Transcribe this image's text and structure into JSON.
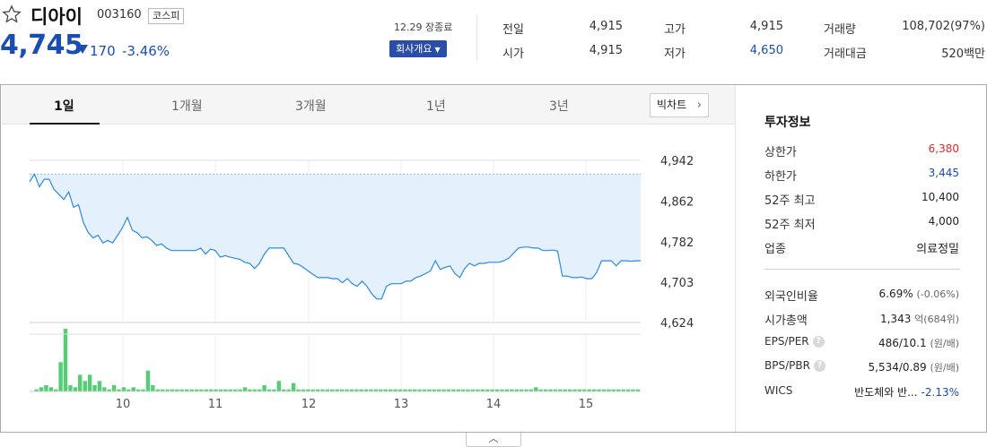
{
  "stock": {
    "name": "디아이",
    "code": "003160",
    "market": "코스피",
    "price": "4,745",
    "change": "170",
    "change_rate": "-3.46%",
    "as_of": "12.29 장종료",
    "company_button": "회사개요"
  },
  "quotes": {
    "prev_close_label": "전일",
    "prev_close": "4,915",
    "open_label": "시가",
    "open": "4,915",
    "high_label": "고가",
    "high": "4,915",
    "low_label": "저가",
    "low": "4,650",
    "volume_label": "거래량",
    "volume": "108,702(97%)",
    "trade_value_label": "거래대금",
    "trade_value": "520백만"
  },
  "tabs": [
    {
      "label": "1일",
      "active": true
    },
    {
      "label": "1개월",
      "active": false
    },
    {
      "label": "3개월",
      "active": false
    },
    {
      "label": "1년",
      "active": false
    },
    {
      "label": "3년",
      "active": false
    }
  ],
  "big_chart_label": "빅차트",
  "chart_data": {
    "type": "area",
    "y_ticks": [
      "4,942",
      "4,862",
      "4,782",
      "4,703",
      "4,624"
    ],
    "ylim": [
      4624,
      4942
    ],
    "prev_close": 4915,
    "x_ticks": [
      "10",
      "11",
      "12",
      "13",
      "14",
      "15"
    ],
    "price_series": [
      4900,
      4915,
      4890,
      4905,
      4905,
      4885,
      4875,
      4865,
      4880,
      4850,
      4855,
      4820,
      4800,
      4790,
      4795,
      4780,
      4785,
      4780,
      4795,
      4810,
      4830,
      4805,
      4800,
      4790,
      4792,
      4785,
      4775,
      4778,
      4770,
      4765,
      4765,
      4765,
      4765,
      4765,
      4765,
      4770,
      4758,
      4768,
      4765,
      4752,
      4755,
      4752,
      4750,
      4748,
      4742,
      4740,
      4730,
      4740,
      4758,
      4770,
      4770,
      4770,
      4770,
      4755,
      4740,
      4738,
      4732,
      4725,
      4718,
      4712,
      4712,
      4712,
      4710,
      4710,
      4702,
      4710,
      4700,
      4695,
      4705,
      4695,
      4680,
      4670,
      4670,
      4695,
      4700,
      4700,
      4700,
      4705,
      4705,
      4712,
      4715,
      4720,
      4725,
      4745,
      4728,
      4732,
      4735,
      4720,
      4712,
      4730,
      4740,
      4735,
      4740,
      4740,
      4742,
      4742,
      4742,
      4745,
      4750,
      4760,
      4770,
      4772,
      4772,
      4770,
      4770,
      4765,
      4765,
      4766,
      4764,
      4715,
      4715,
      4712,
      4712,
      4713,
      4710,
      4710,
      4722,
      4745,
      4745,
      4745,
      4735,
      4745,
      4745,
      4744,
      4745,
      4745
    ],
    "volume_series": [
      0,
      1,
      2,
      3,
      2,
      1,
      14,
      30,
      3,
      2,
      8,
      5,
      8,
      3,
      5,
      2,
      1,
      3,
      1,
      2,
      1,
      2,
      1,
      1,
      10,
      3,
      1,
      1,
      1,
      1,
      1,
      1,
      1,
      1,
      1,
      1,
      1,
      1,
      1,
      1,
      1,
      1,
      1,
      1,
      2,
      1,
      1,
      1,
      3,
      1,
      1,
      5,
      1,
      1,
      4,
      1,
      1,
      1,
      1,
      1,
      1,
      1,
      1,
      1,
      1,
      1,
      1,
      1,
      1,
      1,
      1,
      1,
      1,
      1,
      1,
      1,
      1,
      1,
      1,
      1,
      1,
      1,
      1,
      1,
      1,
      1,
      1,
      1,
      1,
      1,
      1,
      1,
      1,
      1,
      1,
      1,
      1,
      1,
      1,
      1,
      1,
      1,
      1,
      1,
      2,
      1,
      1,
      1,
      1,
      1,
      1,
      1,
      1,
      1,
      1,
      1,
      1,
      1,
      1,
      1,
      1,
      1,
      1,
      1,
      1,
      1
    ]
  },
  "investment_info": {
    "title": "투자정보",
    "rows": [
      {
        "label": "상한가",
        "value": "6,380",
        "color": "red"
      },
      {
        "label": "하한가",
        "value": "3,445",
        "color": "blue"
      },
      {
        "label": "52주 최고",
        "value": "10,400",
        "color": ""
      },
      {
        "label": "52주 최저",
        "value": "4,000",
        "color": ""
      },
      {
        "label": "업종",
        "value": "의료정밀",
        "color": ""
      }
    ],
    "foreign_ratio_label": "외국인비율",
    "foreign_ratio": "6.69%",
    "foreign_ratio_change": "(-0.06%)",
    "market_cap_label": "시가총액",
    "market_cap": "1,343",
    "market_cap_unit": "억(684위)",
    "eps_per_label": "EPS/PER",
    "eps_per": "486/10.1",
    "eps_per_unit": "(원/배)",
    "bps_pbr_label": "BPS/PBR",
    "bps_pbr": "5,534/0.89",
    "bps_pbr_unit": "(원/배)",
    "wics_label": "WICS",
    "wics": "반도체와 반...",
    "wics_change": "-2.13%"
  },
  "colors": {
    "down": "#1a4db3",
    "up": "#e0262b",
    "line": "#2b89e6",
    "fill": "#e4f0fc",
    "volume": "#52cf72"
  }
}
